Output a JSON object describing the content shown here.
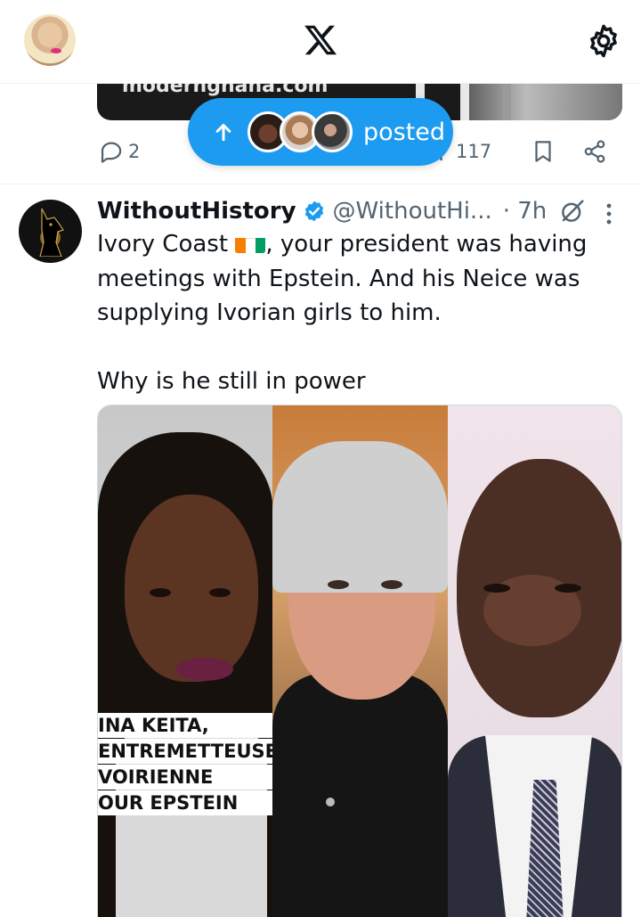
{
  "header": {
    "logo": "x-logo-icon",
    "settings_icon": "gear-icon"
  },
  "prev_post": {
    "media_text": "modernghana.com",
    "reply_count": "2",
    "view_count": "117"
  },
  "posted_pill": {
    "label": "posted"
  },
  "tweet": {
    "name": "WithoutHistory",
    "handle": "@WithoutHi...",
    "time": "· 7h",
    "text_before_flag": "Ivory Coast ",
    "text_after_flag": ", your president was having meetings with Epstein. And his Neice was supplying Ivorian girls to him.\n\nWhy is he still in power",
    "media_caption": [
      "INA KEITA,",
      "ENTREMETTEUSE",
      "VOIRIENNE",
      "OUR EPSTEIN"
    ]
  },
  "colors": {
    "accent": "#1d9bf0",
    "secondary_text": "#536471",
    "flag_orange": "#f77f00",
    "flag_white": "#ffffff",
    "flag_green": "#009e60"
  }
}
